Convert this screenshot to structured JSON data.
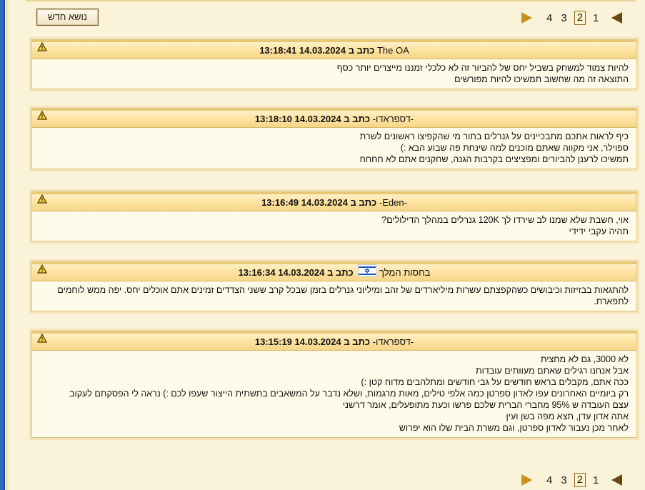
{
  "toolbar": {
    "new_topic_label": "נושא חדש",
    "pagination": {
      "pages": [
        "4",
        "3",
        "2",
        "1"
      ],
      "current": "2"
    }
  },
  "icons": {
    "warning": "warning-icon",
    "next_page": "triangle-right-icon",
    "prev_page": "triangle-left-icon",
    "flag": "israel-flag-icon"
  },
  "colors": {
    "accent": "#c9901e",
    "header_bg": "#fde3a0",
    "body_bg": "#fffbea"
  },
  "posts": [
    {
      "author": "The OA",
      "written_label": "כתב ב",
      "datetime": "14.03.2024 13:18:41",
      "lines": [
        "להיות צמוד למשחק בשביל יחס של להביור זה לא כלכלי זמננו מייצרים יותר כסף",
        "התוצאה זה מה שחשוב תמשיכו להיות מפורשים"
      ]
    },
    {
      "author": "-דספראדו-",
      "written_label": "כתב ב",
      "datetime": "14.03.2024 13:18:10",
      "lines": [
        "כיף לראות אתכם מתבכיינים על גנרלים בתור מי שהקפיצו ראשונים לשרת",
        "ספוילר, אני מקווה שאתם מוכנים למה שינחת פה שבוע הבא :)",
        "תמשיכו לרענן להביורים ומפציצים בקרבות הגנה, שחקנים אתם לא חחחח"
      ]
    },
    {
      "author": "-Eden-",
      "written_label": "כתב ב",
      "datetime": "14.03.2024 13:16:49",
      "lines": [
        "אוי, חשבת שלא שמנו לב שירדו לך 120K גנרלים במהלך הדילולים?",
        "תהיה עקבי ידידי"
      ]
    },
    {
      "author": "בחסות המלך",
      "written_label": "כתב ב",
      "datetime": "14.03.2024 13:16:34",
      "lines": [
        "להתגאות בבזיזות וכיבושים כשהקפצתם עשרות מיליארדים של זהב ומיליוני גנרלים בזמן שבכל קרב ששני הצדדים זמינים אתם אוכלים יחס. יפה ממש לוחמים לתפארת."
      ]
    },
    {
      "author": "-דספראדו-",
      "written_label": "כתב ב",
      "datetime": "14.03.2024 13:15:19",
      "lines": [
        "לא 3000, גם לא מחצית",
        "אבל אנחנו רגילים שאתם מעוותים עובדות",
        "ככה אתם, מקבלים בראש חודשים על גבי חודשים ומתלהבים מדוח קטן :)",
        "רק ביומיים האחרונים עפו לאדון ספרטן כמה אלפי טילים, מאות מרגמות, ושלא נדבר על המשאבים בתשתית הייצור שעפו לכם :) נראה לי הפסקתם לעקוב",
        "עצם העובדה ש 95% מחברי הברית שלכם פרשו וכעת מתופעלים, אומר דרשני",
        "אתה אדון עדן, תצא מפה בשן ועין",
        "לאחר מכן נעבור לאדון ספרטן, וגם משרת הבית שלו הוא יפרוש"
      ]
    }
  ]
}
